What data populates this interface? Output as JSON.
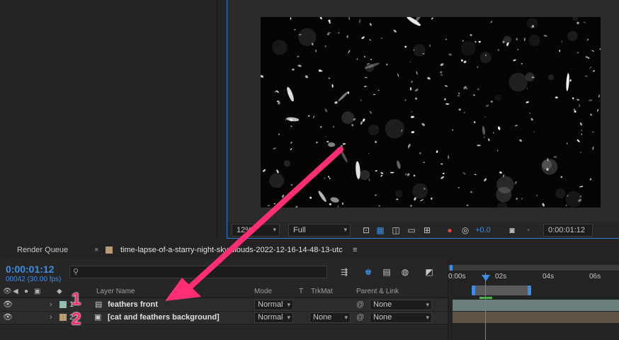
{
  "viewer": {
    "zoom": "12%",
    "resolution": "Full",
    "exposure": "+0.0",
    "current_time": "0:00:01:12"
  },
  "tabs": {
    "render_queue": "Render Queue",
    "close_symbol": "×",
    "comp_name": "time-lapse-of-a-starry-night-sky-clouds-2022-12-16-14-48-13-utc",
    "menu_symbol": "≡"
  },
  "timeline": {
    "timecode": "0:00:01:12",
    "frame_info": "00042 (30.00 fps)",
    "search_placeholder": "",
    "ruler_labels": [
      "0:00s",
      "02s",
      "04s",
      "06s"
    ],
    "columns": {
      "layer_name": "Layer Name",
      "mode": "Mode",
      "t": "T",
      "trkmat": "TrkMat",
      "parent": "Parent & Link"
    },
    "layers": [
      {
        "number": "1",
        "name": "feathers front",
        "mode": "Normal",
        "trkmat": "",
        "parent": "None",
        "label_color": "#8fbfb7"
      },
      {
        "number": "2",
        "name": "[cat and feathers background]",
        "mode": "Normal",
        "trkmat": "None",
        "parent": "None",
        "label_color": "#b89a74"
      }
    ]
  },
  "annotation": {
    "arrow_color": "#ff2e73",
    "labels": [
      "1",
      "2"
    ]
  }
}
